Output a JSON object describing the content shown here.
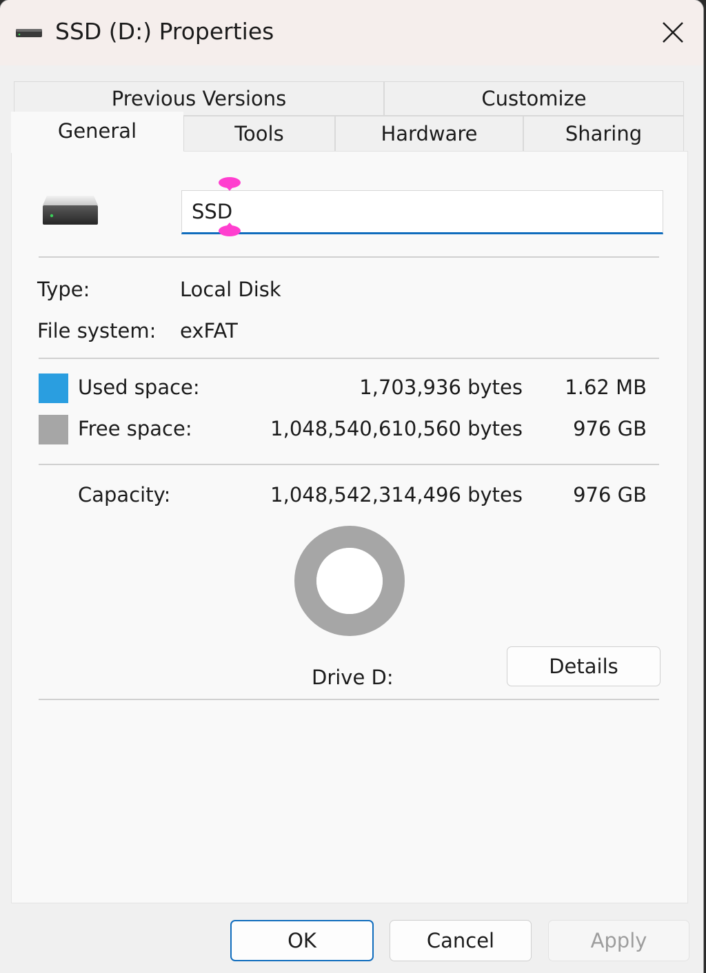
{
  "window": {
    "title": "SSD (D:) Properties"
  },
  "tabs": {
    "row1": [
      "Previous Versions",
      "Customize"
    ],
    "row2": [
      "General",
      "Tools",
      "Hardware",
      "Sharing"
    ],
    "selected": "General"
  },
  "general": {
    "name_value": "SSD",
    "type_label": "Type:",
    "type_value": "Local Disk",
    "fs_label": "File system:",
    "fs_value": "exFAT",
    "used_label": "Used space:",
    "used_bytes": "1,703,936 bytes",
    "used_size": "1.62 MB",
    "free_label": "Free space:",
    "free_bytes": "1,048,540,610,560 bytes",
    "free_size": "976 GB",
    "capacity_label": "Capacity:",
    "capacity_bytes": "1,048,542,314,496 bytes",
    "capacity_size": "976 GB",
    "drive_label": "Drive D:",
    "details_label": "Details",
    "used_fraction": 1.6e-06
  },
  "footer": {
    "ok_label": "OK",
    "cancel_label": "Cancel",
    "apply_label": "Apply"
  },
  "colors": {
    "used": "#2a9ee0",
    "free": "#a6a6a6",
    "accent": "#0f6cbd"
  },
  "icons": {
    "title": "drive-icon",
    "close": "close-icon",
    "drive_large": "drive-icon"
  }
}
